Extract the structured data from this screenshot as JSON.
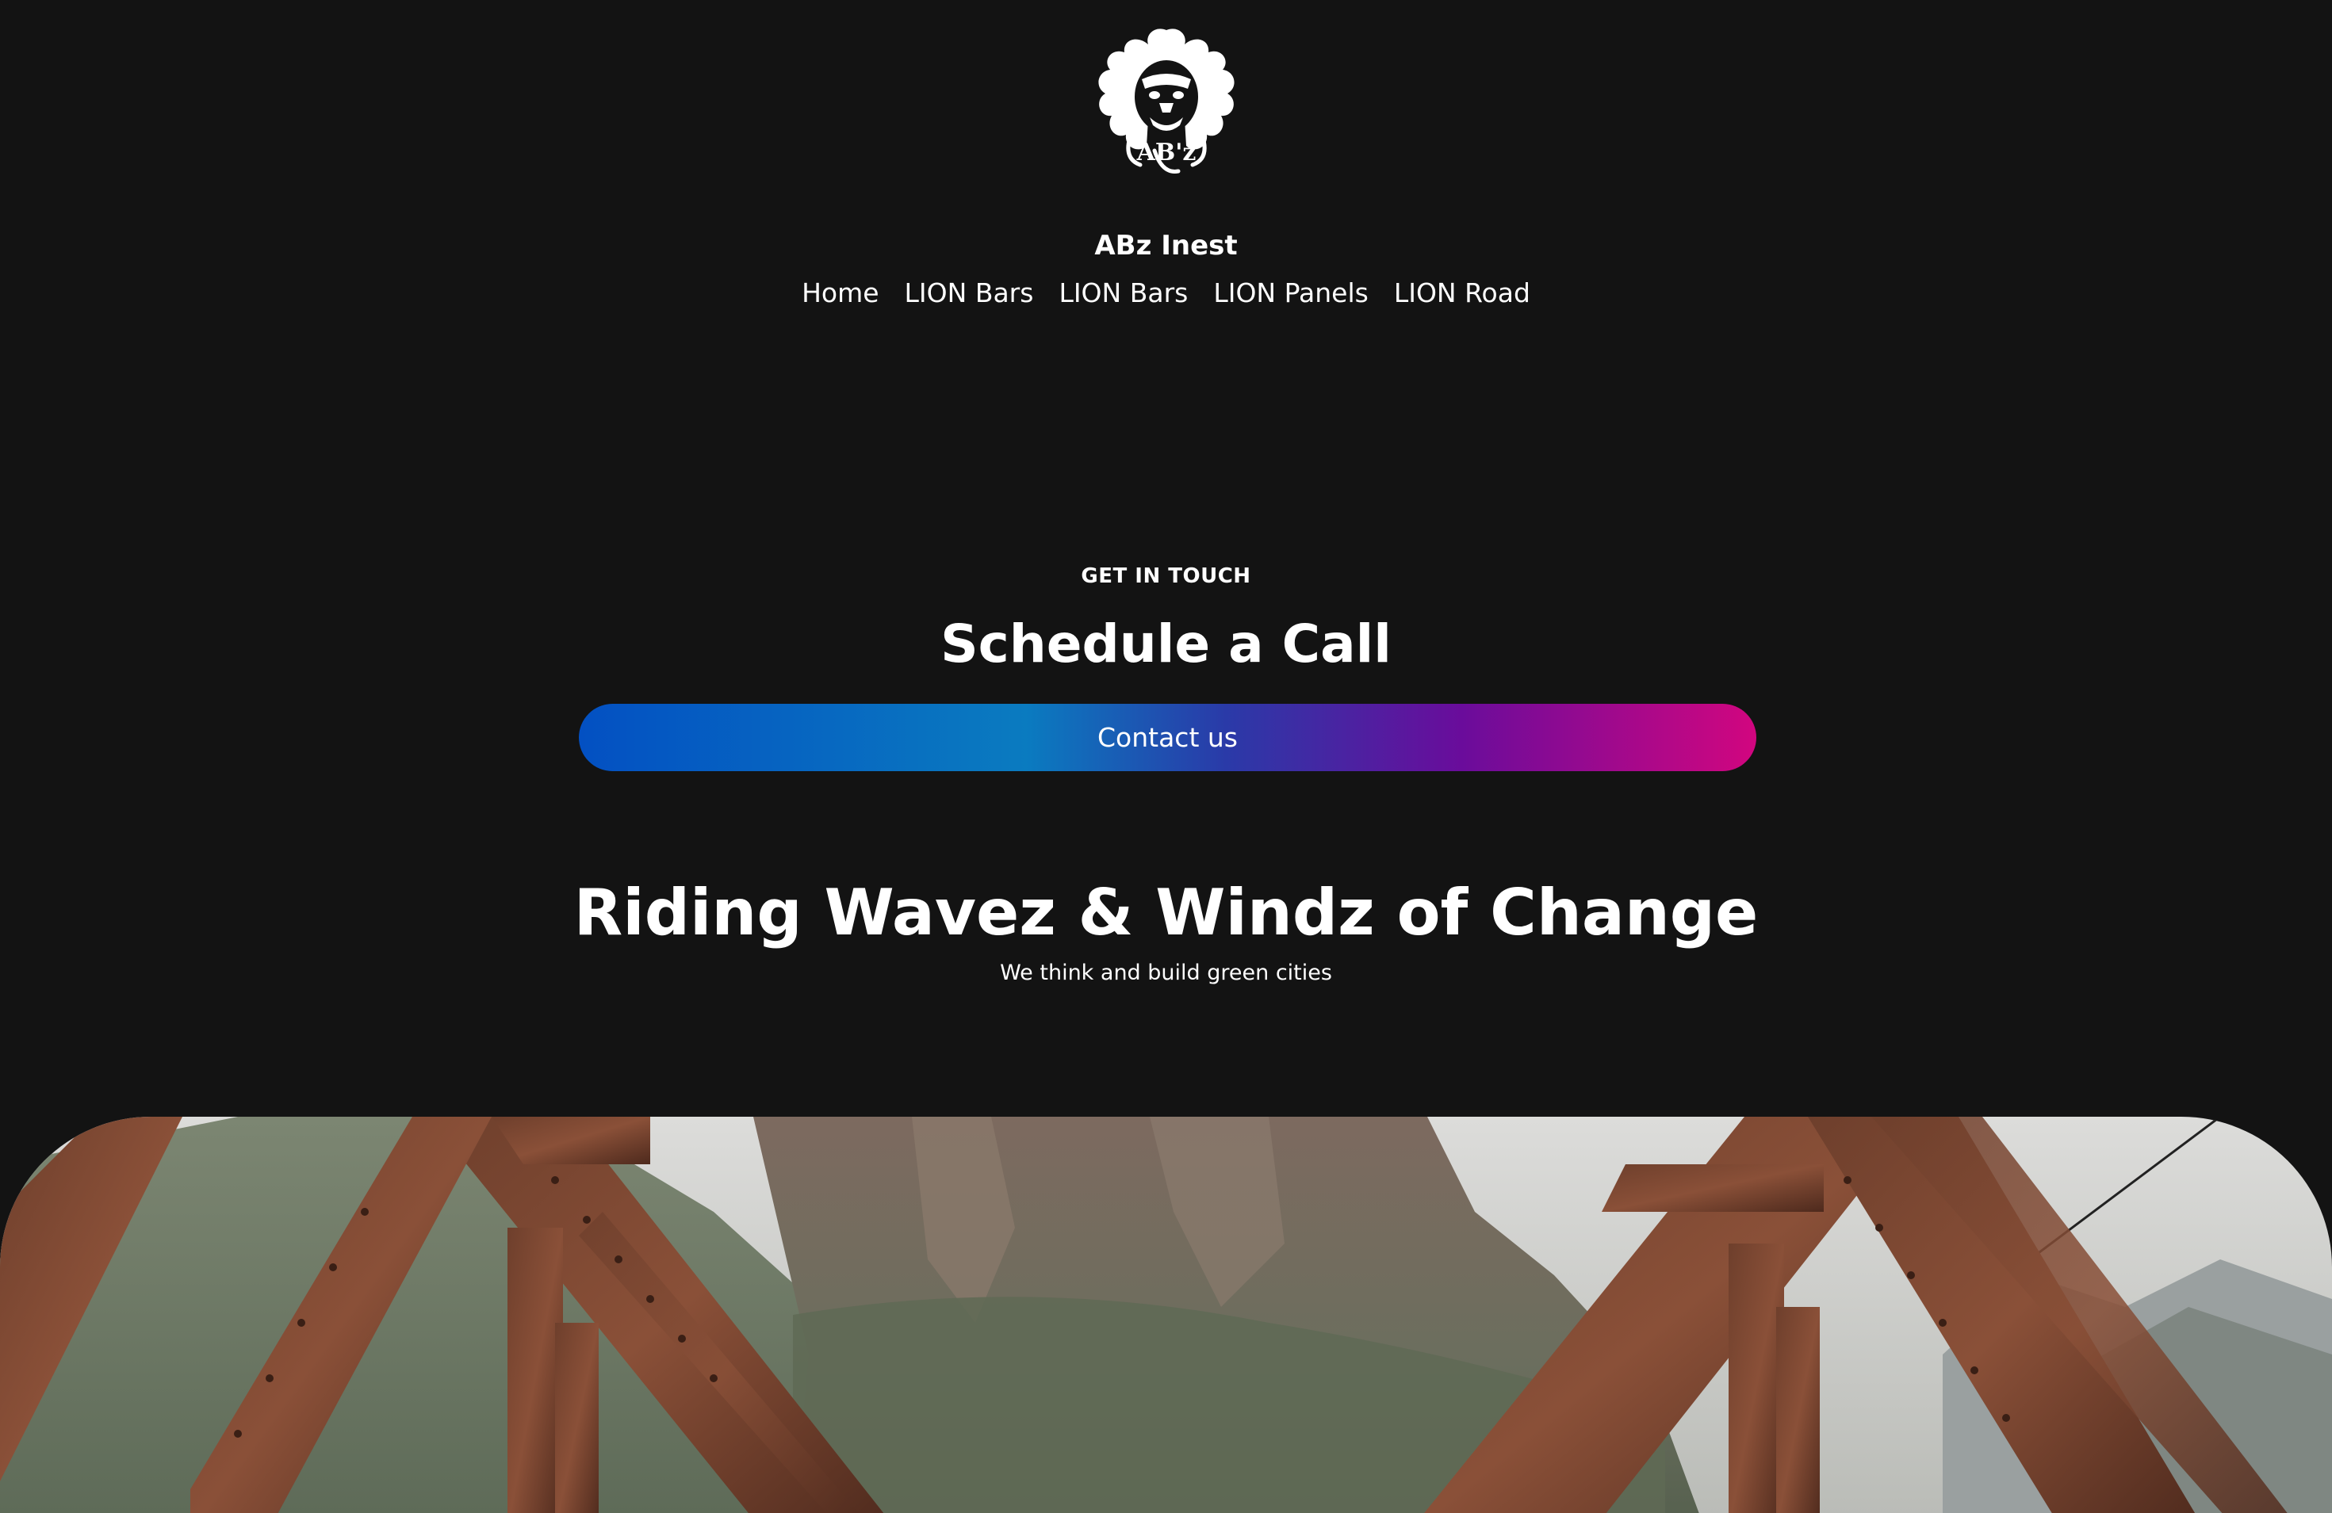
{
  "header": {
    "logo_text": "AB'z",
    "site_title": "ABz Inest",
    "nav": [
      {
        "label": "Home"
      },
      {
        "label": "LION Bars"
      },
      {
        "label": "LION Bars"
      },
      {
        "label": "LION Panels"
      },
      {
        "label": "LION Road"
      }
    ]
  },
  "contact": {
    "eyebrow": "GET IN TOUCH",
    "heading": "Schedule a Call",
    "button_label": "Contact us",
    "gradient_colors": [
      "#0350c2",
      "#0a7bc0",
      "#6a0c9b",
      "#d2067f"
    ]
  },
  "hero": {
    "heading": "Riding Wavez & Windz of Change",
    "subheading": "We think and build green cities",
    "image_icon": "bridge-photo-icon"
  },
  "colors": {
    "background": "#131313",
    "text": "#ffffff"
  }
}
